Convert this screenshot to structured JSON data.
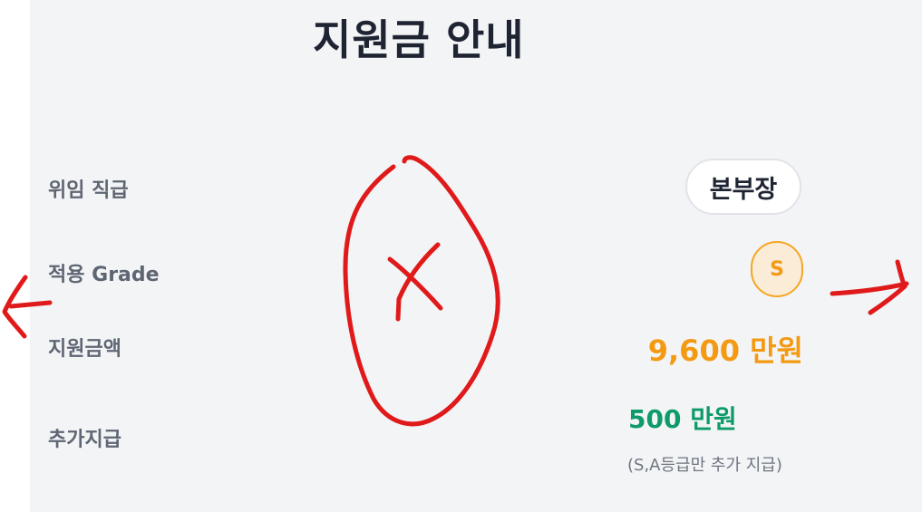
{
  "header": {
    "title": "지원금 안내"
  },
  "rows": {
    "rank": {
      "label": "위임 직급",
      "value": "본부장"
    },
    "grade": {
      "label": "적용 Grade",
      "value": "S"
    },
    "amount": {
      "label": "지원금액",
      "value": "9,600 만원"
    },
    "extra": {
      "label": "추가지급",
      "value": "500 만원",
      "note": "(S,A등급만 추가 지급)"
    }
  },
  "colors": {
    "panel_background": "#f3f4f6",
    "amount": "#f39a12",
    "extra": "#0e9b6a",
    "annotation": "#e01a1a"
  }
}
